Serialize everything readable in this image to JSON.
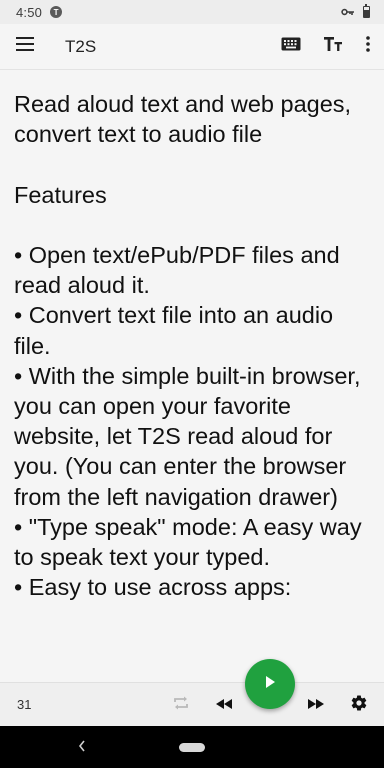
{
  "status_bar": {
    "time": "4:50",
    "app_badge": "T"
  },
  "app_bar": {
    "title": "T2S",
    "icons": [
      "menu-icon",
      "keyboard-icon",
      "text-size-icon",
      "more-vert-icon"
    ]
  },
  "content": {
    "text": "Read aloud text and web pages, convert text to audio file\n\nFeatures\n\n• Open text/ePub/PDF files and read aloud it.\n• Convert text file into an audio file.\n• With the simple built-in browser, you can open your favorite website, let T2S read aloud for you. (You can enter the browser from the left navigation drawer)\n• \"Type speak\" mode: A easy way to speak text your typed.\n• Easy to use across apps:"
  },
  "player": {
    "count": "31",
    "icons": [
      "repeat-icon",
      "rewind-icon",
      "play-icon",
      "fast-forward-icon",
      "settings-icon"
    ],
    "accent": "#20a13f"
  },
  "nav_bar": {
    "icons": [
      "back-icon",
      "home-pill"
    ]
  }
}
